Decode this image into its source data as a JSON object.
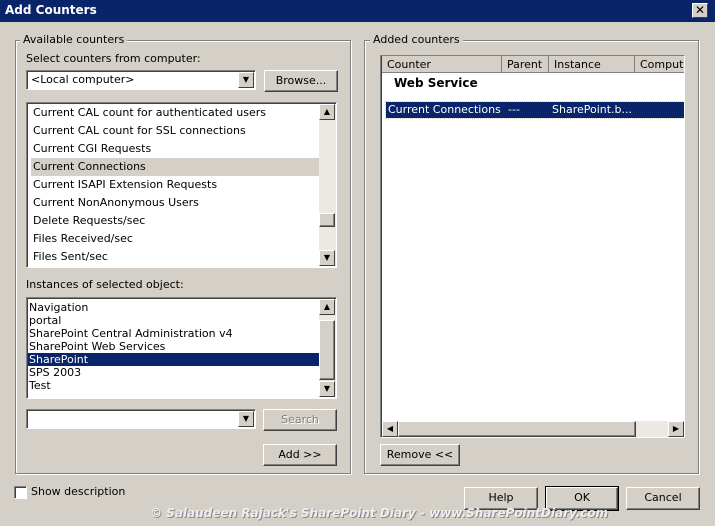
{
  "window": {
    "title": "Add Counters",
    "close": "✕"
  },
  "available": {
    "group_label": "Available counters",
    "computer_label": "Select counters from computer:",
    "computer_value": "<Local computer>",
    "browse_label": "Browse...",
    "counters": [
      "Current CAL count for authenticated users",
      "Current CAL count for SSL connections",
      "Current CGI Requests",
      "Current Connections",
      "Current ISAPI Extension Requests",
      "Current NonAnonymous Users",
      "Delete Requests/sec",
      "Files Received/sec",
      "Files Sent/sec"
    ],
    "selected_counter": "Current Connections",
    "instances_label": "Instances of selected object:",
    "instances": [
      "Navigation",
      "portal",
      "SharePoint Central Administration v4",
      "SharePoint Web Services",
      "SharePoint",
      "SPS 2003",
      "Test"
    ],
    "selected_instance": "SharePoint",
    "search_value": "",
    "search_label": "Search",
    "add_label": "Add >>"
  },
  "added": {
    "group_label": "Added counters",
    "columns": [
      "Counter",
      "Parent",
      "Instance",
      "Computer"
    ],
    "group_heading": "Web Service",
    "row": {
      "counter": "Current Connections",
      "parent": "---",
      "instance": "SharePoint.b...",
      "computer": ""
    },
    "remove_label": "Remove <<"
  },
  "show_description": {
    "label": "Show description",
    "checked": false
  },
  "footer": {
    "help_label": "Help",
    "ok_label": "OK",
    "cancel_label": "Cancel",
    "watermark": "© Salaudeen Rajack's SharePoint Diary - www.SharePointDiary.com"
  }
}
